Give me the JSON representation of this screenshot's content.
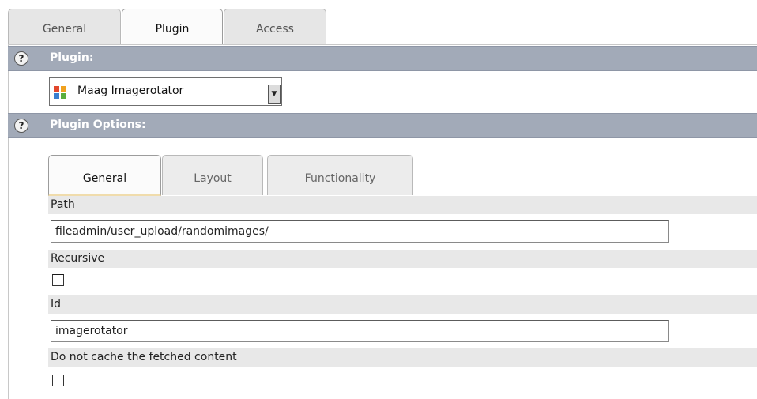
{
  "outer_tabs": [
    "General",
    "Plugin",
    "Access"
  ],
  "active_outer_tab": "Plugin",
  "sections": {
    "plugin": {
      "help": "?",
      "title": "Plugin:"
    },
    "options": {
      "help": "?",
      "title": "Plugin Options:"
    }
  },
  "plugin_select": {
    "value": "Maag Imagerotator",
    "icon": "plugin-logo-icon"
  },
  "inner_tabs": [
    "General",
    "Layout",
    "Functionality"
  ],
  "active_inner_tab": "General",
  "fields": {
    "path": {
      "label": "Path",
      "value": "fileadmin/user_upload/randomimages/"
    },
    "recursive": {
      "label": "Recursive",
      "checked": false
    },
    "id": {
      "label": "Id",
      "value": "imagerotator"
    },
    "no_cache": {
      "label": "Do not cache the fetched content",
      "checked": false
    }
  },
  "colors": {
    "section_header": "#a2aab8",
    "active_tab_underline": "#f0dcac"
  }
}
